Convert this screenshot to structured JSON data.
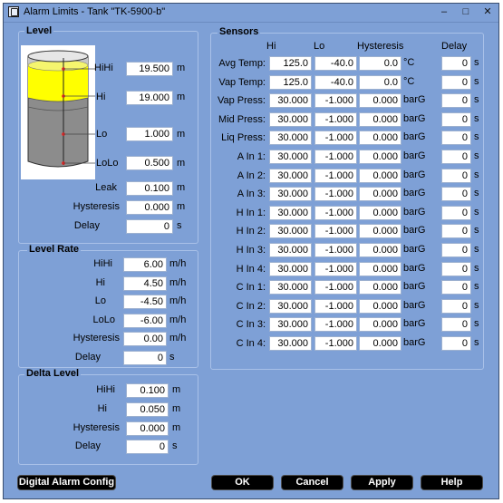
{
  "window": {
    "title": "Alarm Limits - Tank \"TK-5900-b\"",
    "controls": [
      "–",
      "□",
      "✕"
    ]
  },
  "level": {
    "title": "Level",
    "rows": [
      {
        "label": "HiHi",
        "value": "19.500",
        "unit": "m"
      },
      {
        "label": "Hi",
        "value": "19.000",
        "unit": "m"
      },
      {
        "label": "Lo",
        "value": "1.000",
        "unit": "m"
      },
      {
        "label": "LoLo",
        "value": "0.500",
        "unit": "m"
      },
      {
        "label": "Leak",
        "value": "0.100",
        "unit": "m"
      },
      {
        "label": "Hysteresis",
        "value": "0.000",
        "unit": "m"
      },
      {
        "label": "Delay",
        "value": "0",
        "unit": "s"
      }
    ]
  },
  "level_rate": {
    "title": "Level Rate",
    "rows": [
      {
        "label": "HiHi",
        "value": "6.00",
        "unit": "m/h"
      },
      {
        "label": "Hi",
        "value": "4.50",
        "unit": "m/h"
      },
      {
        "label": "Lo",
        "value": "-4.50",
        "unit": "m/h"
      },
      {
        "label": "LoLo",
        "value": "-6.00",
        "unit": "m/h"
      },
      {
        "label": "Hysteresis",
        "value": "0.00",
        "unit": "m/h"
      },
      {
        "label": "Delay",
        "value": "0",
        "unit": "s"
      }
    ]
  },
  "delta_level": {
    "title": "Delta Level",
    "rows": [
      {
        "label": "HiHi",
        "value": "0.100",
        "unit": "m"
      },
      {
        "label": "Hi",
        "value": "0.050",
        "unit": "m"
      },
      {
        "label": "Hysteresis",
        "value": "0.000",
        "unit": "m"
      },
      {
        "label": "Delay",
        "value": "0",
        "unit": "s"
      }
    ]
  },
  "sensors": {
    "title": "Sensors",
    "headers": {
      "hi": "Hi",
      "lo": "Lo",
      "hysteresis": "Hysteresis",
      "delay": "Delay"
    },
    "rows": [
      {
        "label": "Avg Temp:",
        "hi": "125.0",
        "lo": "-40.0",
        "hyst": "0.0",
        "unit": "°C",
        "delay": "0",
        "dunit": "s"
      },
      {
        "label": "Vap Temp:",
        "hi": "125.0",
        "lo": "-40.0",
        "hyst": "0.0",
        "unit": "°C",
        "delay": "0",
        "dunit": "s"
      },
      {
        "label": "Vap Press:",
        "hi": "30.000",
        "lo": "-1.000",
        "hyst": "0.000",
        "unit": "barG",
        "delay": "0",
        "dunit": "s"
      },
      {
        "label": "Mid Press:",
        "hi": "30.000",
        "lo": "-1.000",
        "hyst": "0.000",
        "unit": "barG",
        "delay": "0",
        "dunit": "s"
      },
      {
        "label": "Liq Press:",
        "hi": "30.000",
        "lo": "-1.000",
        "hyst": "0.000",
        "unit": "barG",
        "delay": "0",
        "dunit": "s"
      },
      {
        "label": "A In 1:",
        "hi": "30.000",
        "lo": "-1.000",
        "hyst": "0.000",
        "unit": "barG",
        "delay": "0",
        "dunit": "s"
      },
      {
        "label": "A In 2:",
        "hi": "30.000",
        "lo": "-1.000",
        "hyst": "0.000",
        "unit": "barG",
        "delay": "0",
        "dunit": "s"
      },
      {
        "label": "A In 3:",
        "hi": "30.000",
        "lo": "-1.000",
        "hyst": "0.000",
        "unit": "barG",
        "delay": "0",
        "dunit": "s"
      },
      {
        "label": "H In 1:",
        "hi": "30.000",
        "lo": "-1.000",
        "hyst": "0.000",
        "unit": "barG",
        "delay": "0",
        "dunit": "s"
      },
      {
        "label": "H In 2:",
        "hi": "30.000",
        "lo": "-1.000",
        "hyst": "0.000",
        "unit": "barG",
        "delay": "0",
        "dunit": "s"
      },
      {
        "label": "H In 3:",
        "hi": "30.000",
        "lo": "-1.000",
        "hyst": "0.000",
        "unit": "barG",
        "delay": "0",
        "dunit": "s"
      },
      {
        "label": "H In 4:",
        "hi": "30.000",
        "lo": "-1.000",
        "hyst": "0.000",
        "unit": "barG",
        "delay": "0",
        "dunit": "s"
      },
      {
        "label": "C In 1:",
        "hi": "30.000",
        "lo": "-1.000",
        "hyst": "0.000",
        "unit": "barG",
        "delay": "0",
        "dunit": "s"
      },
      {
        "label": "C In 2:",
        "hi": "30.000",
        "lo": "-1.000",
        "hyst": "0.000",
        "unit": "barG",
        "delay": "0",
        "dunit": "s"
      },
      {
        "label": "C In 3:",
        "hi": "30.000",
        "lo": "-1.000",
        "hyst": "0.000",
        "unit": "barG",
        "delay": "0",
        "dunit": "s"
      },
      {
        "label": "C In 4:",
        "hi": "30.000",
        "lo": "-1.000",
        "hyst": "0.000",
        "unit": "barG",
        "delay": "0",
        "dunit": "s"
      }
    ]
  },
  "buttons": {
    "digital_alarm_config": "Digital Alarm Config",
    "ok": "OK",
    "cancel": "Cancel",
    "apply": "Apply",
    "help": "Help"
  },
  "colors": {
    "window_bg": "#7ea0d6",
    "tank_liquid": "#ffff00",
    "tank_body": "#8a8a8a",
    "marker": "#e02020"
  }
}
